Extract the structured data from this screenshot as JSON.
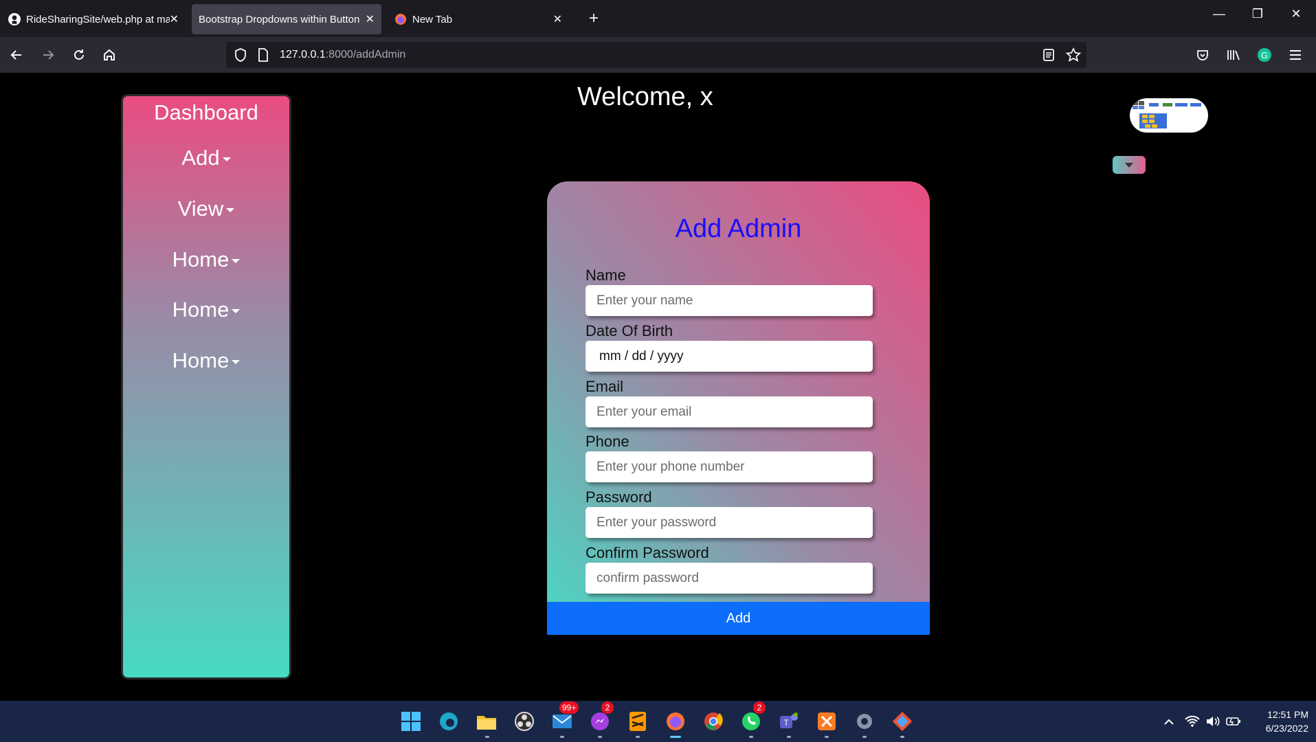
{
  "browser": {
    "tabs": [
      {
        "title": "RideSharingSite/web.php at ma",
        "favicon": "github-icon",
        "active": false
      },
      {
        "title": "Bootstrap Dropdowns within Button",
        "favicon": "none",
        "active": true
      },
      {
        "title": "New Tab",
        "favicon": "firefox-icon",
        "active": false
      }
    ],
    "url_host": "127.0.0.1",
    "url_path": ":8000/addAdmin"
  },
  "sidebar": {
    "title": "Dashboard",
    "items": [
      {
        "label": "Add"
      },
      {
        "label": "View"
      },
      {
        "label": "Home"
      },
      {
        "label": "Home"
      },
      {
        "label": "Home"
      }
    ]
  },
  "header": {
    "welcome": "Welcome, x"
  },
  "form": {
    "title": "Add Admin",
    "fields": [
      {
        "label": "Name",
        "placeholder": "Enter your name"
      },
      {
        "label": "Date Of Birth",
        "value": "mm / dd / yyyy"
      },
      {
        "label": "Email",
        "placeholder": "Enter your email"
      },
      {
        "label": "Phone",
        "placeholder": "Enter your phone number"
      },
      {
        "label": "Password",
        "placeholder": "Enter your password"
      },
      {
        "label": "Confirm Password",
        "placeholder": "confirm password"
      }
    ],
    "submit_label": "Add"
  },
  "taskbar": {
    "badges": {
      "mail": "99+",
      "messenger": "2",
      "whatsapp": "2"
    },
    "time": "12:51 PM",
    "date": "6/23/2022"
  },
  "colors": {
    "accent_blue": "#0d6efd",
    "title_blue": "#1a0dff",
    "gradient_pink": "#ea4c82",
    "gradient_teal": "#47dac3"
  }
}
